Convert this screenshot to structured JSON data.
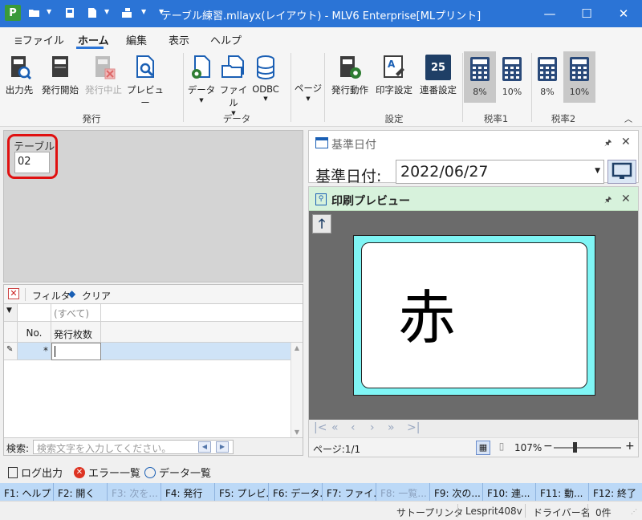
{
  "window": {
    "app_icon": "P",
    "title": "テーブル練習.mllayx(レイアウト) - MLV6 Enterprise[MLプリント]",
    "minimize": "—",
    "maximize": "☐",
    "close": "✕"
  },
  "menu": {
    "file": "ファイル",
    "home": "ホーム",
    "edit": "編集",
    "view": "表示",
    "help": "ヘルプ"
  },
  "ribbon": {
    "issue_group": "発行",
    "data_group": "データ",
    "settings_group": "設定",
    "tax1_group": "税率1",
    "tax2_group": "税率2",
    "output_dest": "出力先",
    "start_issue": "発行開始",
    "stop_issue": "発行中止",
    "preview": "プレビュー",
    "data": "データ",
    "file": "ファイル",
    "odbc": "ODBC",
    "page": "ページ",
    "issue_action": "発行動作",
    "print_settings": "印字設定",
    "serial_settings": "連番設定",
    "serial_icon_text": "25",
    "tax1_a": "8%",
    "tax1_b": "10%",
    "tax2_a": "8%",
    "tax2_b": "10%"
  },
  "table_field": {
    "label": "テーブル",
    "value": "02"
  },
  "grid": {
    "filter": "フィルタ",
    "clear": "クリア",
    "all_filter": "(すべて)",
    "col_no": "No.",
    "col_count": "発行枚数",
    "new_row_marker": "*",
    "search_label": "検索:",
    "search_placeholder": "検索文字を入力してください。"
  },
  "date_panel": {
    "title": "基準日付",
    "label": "基準日付:",
    "value": "2022/06/27"
  },
  "preview_panel": {
    "title": "印刷プレビュー",
    "label_text": "赤",
    "page_info": "ページ:1/1",
    "zoom": "107%"
  },
  "bottom_tabs": {
    "log": "ログ出力",
    "errors": "エラー一覧",
    "data": "データ一覧"
  },
  "fkeys": [
    {
      "label": "F1: ヘルプ",
      "enabled": true
    },
    {
      "label": "F2: 開く",
      "enabled": true
    },
    {
      "label": "F3: 次を...",
      "enabled": false
    },
    {
      "label": "F4: 発行",
      "enabled": true
    },
    {
      "label": "F5: プレビ...",
      "enabled": true
    },
    {
      "label": "F6: データ...",
      "enabled": true
    },
    {
      "label": "F7: ファイ...",
      "enabled": true
    },
    {
      "label": "F8: 一覧...",
      "enabled": false
    },
    {
      "label": "F9: 次の...",
      "enabled": true
    },
    {
      "label": "F10: 連...",
      "enabled": true
    },
    {
      "label": "F11: 動...",
      "enabled": true
    },
    {
      "label": "F12: 終了",
      "enabled": true
    }
  ],
  "status": {
    "printer": "サトープリンタ",
    "model": "Lesprit408v",
    "driver": "ドライバー名",
    "count": "0件"
  },
  "colors": {
    "titlebar": "#2b74d6",
    "highlight_border": "#e01010",
    "label_bg": "#7ff5f5",
    "preview_header": "#d7f2dc",
    "fkey_bg": "#bcd9f7"
  }
}
